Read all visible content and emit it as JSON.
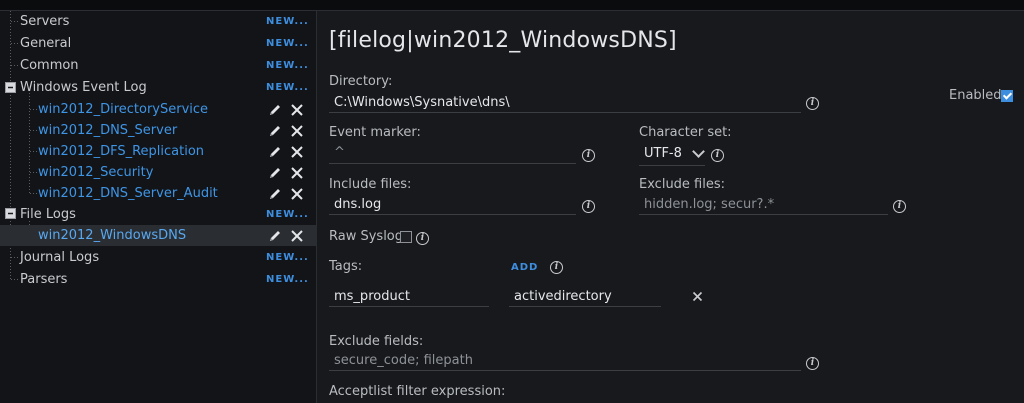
{
  "sidebar": {
    "new_label": "NEW...",
    "items": [
      {
        "label": "Servers"
      },
      {
        "label": "General"
      },
      {
        "label": "Common"
      },
      {
        "label": "Windows Event Log",
        "children": [
          {
            "label": "win2012_DirectoryService"
          },
          {
            "label": "win2012_DNS_Server"
          },
          {
            "label": "win2012_DFS_Replication"
          },
          {
            "label": "win2012_Security"
          },
          {
            "label": "win2012_DNS_Server_Audit"
          }
        ]
      },
      {
        "label": "File Logs",
        "children": [
          {
            "label": "win2012_WindowsDNS",
            "selected": true
          }
        ]
      },
      {
        "label": "Journal Logs"
      },
      {
        "label": "Parsers"
      }
    ]
  },
  "main": {
    "title": "[filelog|win2012_WindowsDNS]",
    "directory": {
      "label": "Directory:",
      "value": "C:\\Windows\\Sysnative\\dns\\"
    },
    "enabled": {
      "label": "Enabled:",
      "checked": true
    },
    "event_marker": {
      "label": "Event marker:",
      "placeholder": "^"
    },
    "character_set": {
      "label": "Character set:",
      "value": "UTF-8"
    },
    "include_files": {
      "label": "Include files:",
      "value": "dns.log"
    },
    "exclude_files": {
      "label": "Exclude files:",
      "placeholder": "hidden.log; secur?.*"
    },
    "raw_syslog": {
      "label": "Raw Syslog:",
      "checked": false
    },
    "tags": {
      "label": "Tags:",
      "add_label": "ADD",
      "key": "ms_product",
      "value": "activedirectory"
    },
    "exclude_fields": {
      "label": "Exclude fields:",
      "placeholder": "secure_code; filepath"
    },
    "acceptlist": {
      "label": "Acceptlist filter expression:"
    }
  },
  "colors": {
    "accent": "#3e8ee0",
    "link": "#3e95e6",
    "background": "#17191c"
  }
}
